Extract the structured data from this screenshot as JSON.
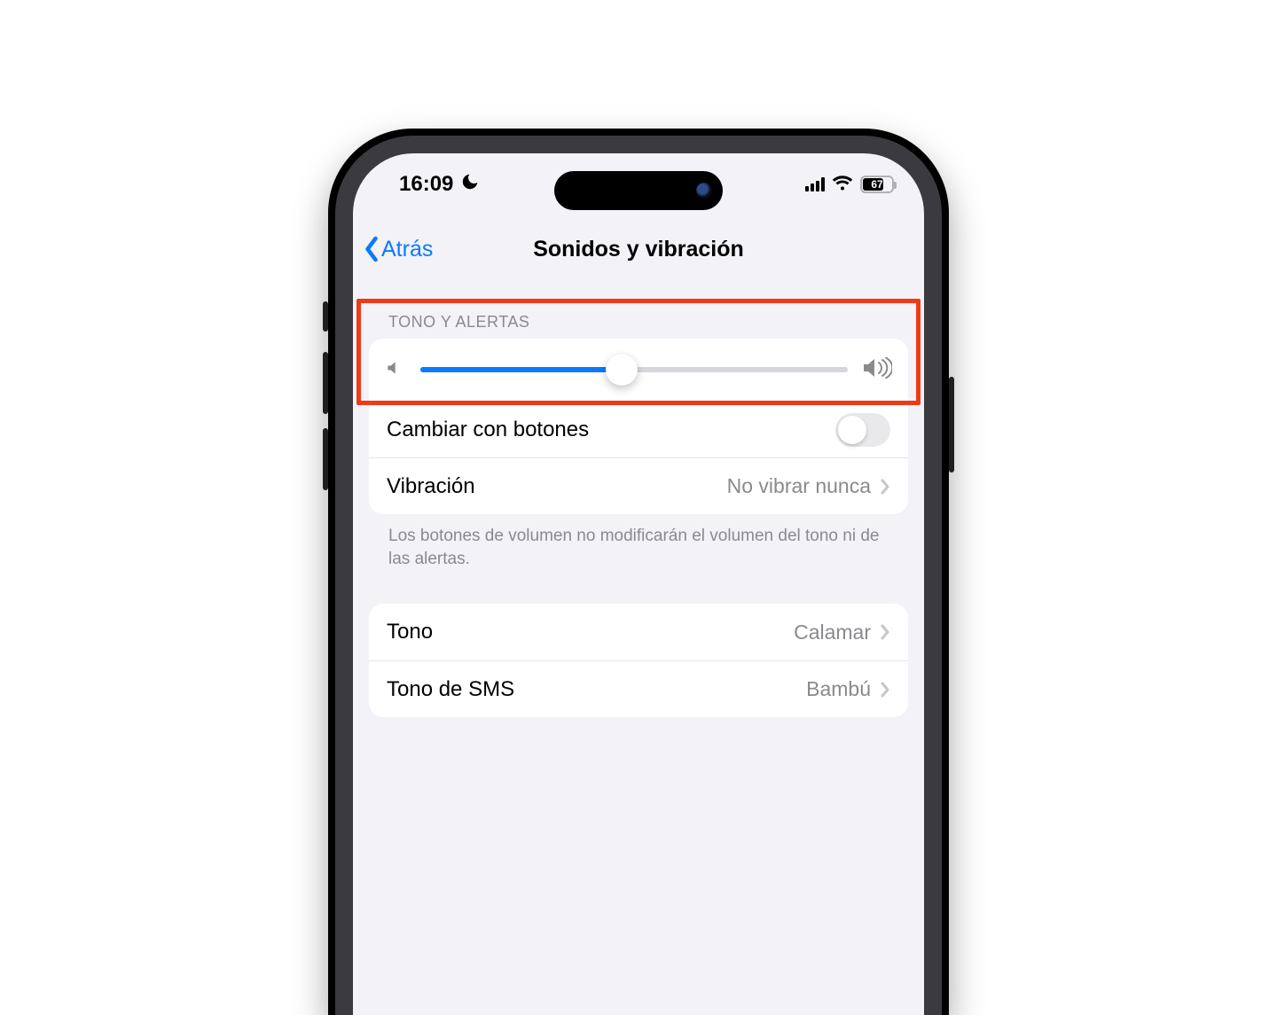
{
  "status": {
    "time": "16:09",
    "focus_icon": "moon-icon",
    "battery_percent": 67
  },
  "nav": {
    "back_label": "Atrás",
    "title": "Sonidos y vibración"
  },
  "sections": {
    "ringer": {
      "header": "TONO Y ALERTAS",
      "slider_percent": 47,
      "change_with_buttons_label": "Cambiar con botones",
      "change_with_buttons_on": false,
      "vibration_label": "Vibración",
      "vibration_value": "No vibrar nunca",
      "footer": "Los botones de volumen no modificarán el volumen del tono ni de las alertas."
    },
    "tones": {
      "ringtone_label": "Tono",
      "ringtone_value": "Calamar",
      "text_tone_label": "Tono de SMS",
      "text_tone_value": "Bambú"
    }
  },
  "colors": {
    "ios_blue": "#0a7aff",
    "highlight": "#f03a17",
    "bg": "#f2f2f7"
  }
}
